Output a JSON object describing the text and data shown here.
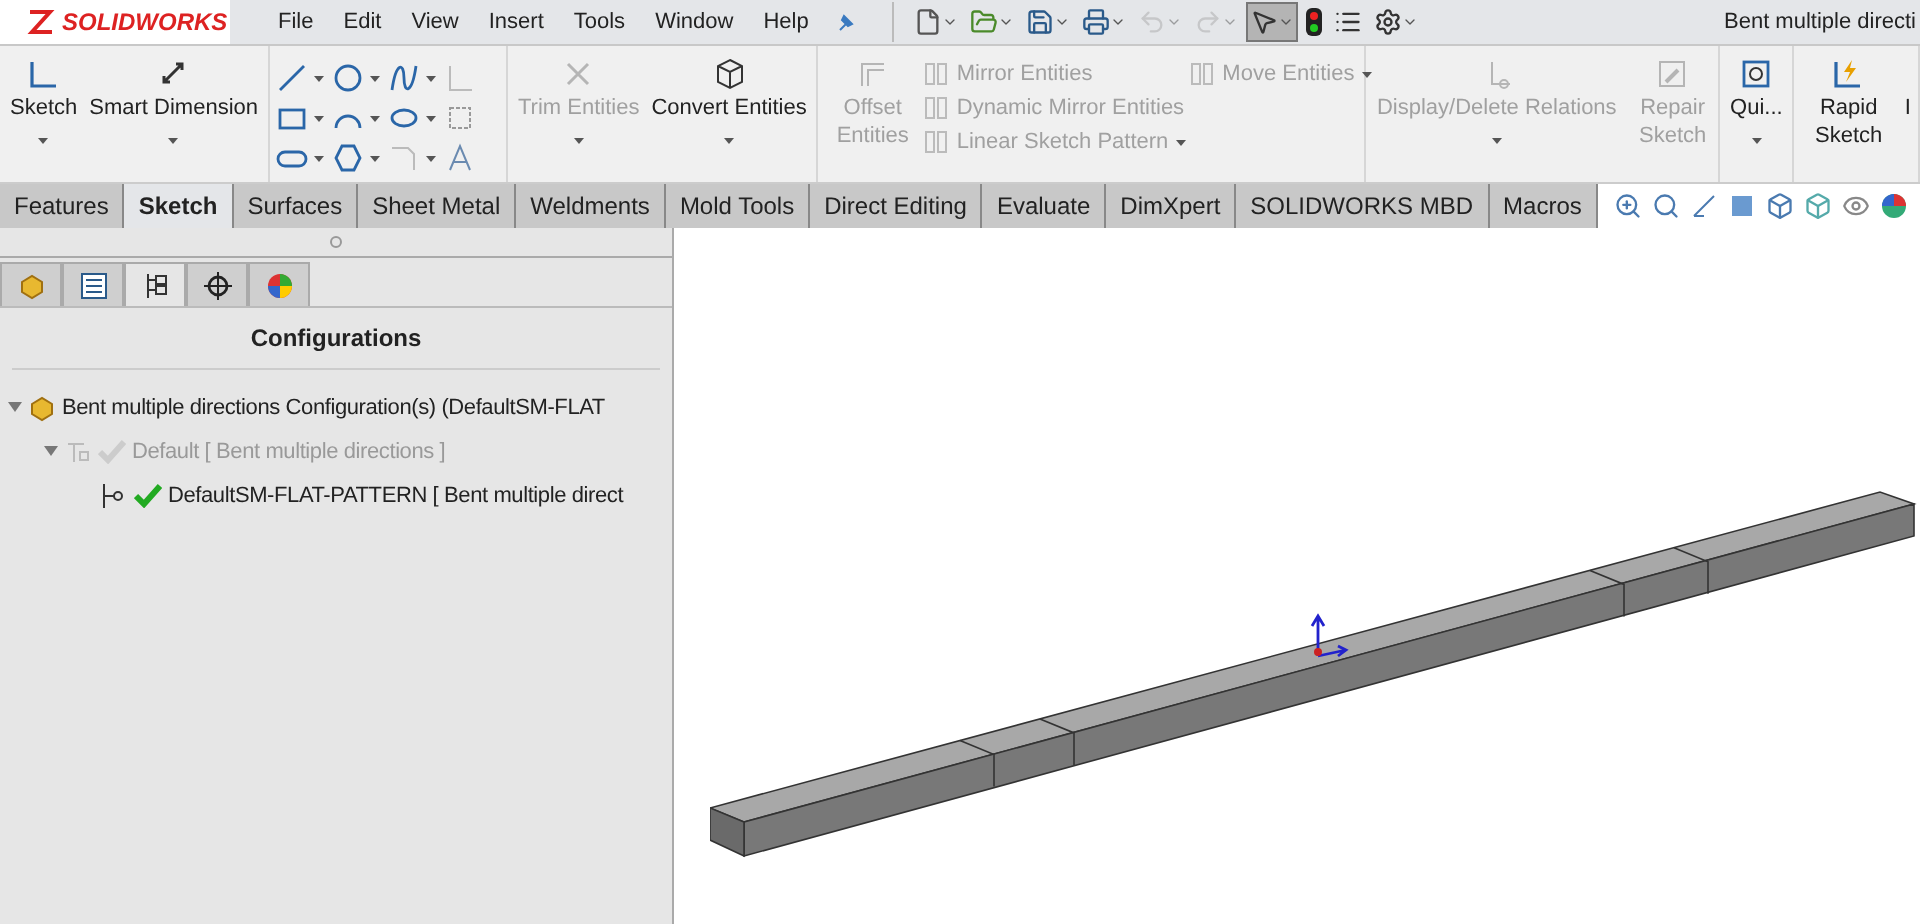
{
  "app": {
    "logo": "SOLIDWORKS",
    "menu": [
      "File",
      "Edit",
      "View",
      "Insert",
      "Tools",
      "Window",
      "Help"
    ],
    "title": "Bent multiple directi"
  },
  "quick_toolbar": [
    {
      "dropdown": true,
      "disabled": false,
      "selected": false
    },
    {
      "dropdown": true,
      "disabled": false,
      "selected": false
    },
    {
      "dropdown": true,
      "disabled": false,
      "selected": false
    },
    {
      "dropdown": true,
      "disabled": false,
      "selected": false
    },
    {
      "dropdown": true,
      "disabled": true,
      "selected": false
    },
    {
      "dropdown": true,
      "disabled": true,
      "selected": false
    },
    {
      "dropdown": true,
      "disabled": false,
      "selected": true
    },
    {
      "dropdown": false,
      "disabled": false,
      "selected": false
    },
    {
      "dropdown": false,
      "disabled": false,
      "selected": false
    },
    {
      "dropdown": true,
      "disabled": false,
      "selected": false
    }
  ],
  "ribbon": {
    "groups": [
      {
        "items": [
          {
            "kind": "large",
            "label": "Sketch",
            "disabled": false,
            "dropdown": true
          },
          {
            "kind": "large",
            "label": "Smart Dimension",
            "disabled": false,
            "dropdown": true
          }
        ]
      },
      {
        "items": [
          {
            "kind": "tools"
          }
        ]
      },
      {
        "items": [
          {
            "kind": "large",
            "label": "Trim Entities",
            "disabled": true,
            "dropdown": true
          },
          {
            "kind": "large",
            "label": "Convert Entities",
            "disabled": false,
            "dropdown": true
          }
        ]
      },
      {
        "items": [
          {
            "kind": "tall",
            "label": "Offset Entities",
            "disabled": true,
            "dropdown": false
          },
          {
            "kind": "stack",
            "items": [
              {
                "label": "Mirror Entities",
                "disabled": true,
                "dropdown": false
              },
              {
                "label": "Dynamic Mirror Entities",
                "disabled": true,
                "dropdown": false
              },
              {
                "label": "Linear Sketch Pattern",
                "disabled": true,
                "dropdown": true
              }
            ]
          },
          {
            "kind": "stack",
            "items": [
              {
                "label": "Move Entities",
                "disabled": true,
                "dropdown": true
              }
            ]
          }
        ]
      },
      {
        "items": [
          {
            "kind": "large",
            "label": "Display/Delete Relations",
            "disabled": true,
            "dropdown": true
          },
          {
            "kind": "tall",
            "label": "Repair Sketch",
            "disabled": true,
            "dropdown": false
          }
        ]
      },
      {
        "items": [
          {
            "kind": "large",
            "label": "Qui...",
            "disabled": false,
            "dropdown": true
          }
        ]
      },
      {
        "items": [
          {
            "kind": "tall",
            "label": "Rapid Sketch",
            "disabled": false,
            "dropdown": false
          },
          {
            "kind": "tall",
            "label": "I",
            "disabled": false,
            "dropdown": false
          }
        ]
      }
    ]
  },
  "tabs": [
    {
      "label": "Features",
      "selected": false
    },
    {
      "label": "Sketch",
      "selected": true
    },
    {
      "label": "Surfaces",
      "selected": false
    },
    {
      "label": "Sheet Metal",
      "selected": false
    },
    {
      "label": "Weldments",
      "selected": false
    },
    {
      "label": "Mold Tools",
      "selected": false
    },
    {
      "label": "Direct Editing",
      "selected": false
    },
    {
      "label": "Evaluate",
      "selected": false
    },
    {
      "label": "DimXpert",
      "selected": false
    },
    {
      "label": "SOLIDWORKS MBD",
      "selected": false
    },
    {
      "label": "Macros",
      "selected": false
    }
  ],
  "panel": {
    "tabs": [
      {
        "selected": false
      },
      {
        "selected": false
      },
      {
        "selected": true
      },
      {
        "selected": false
      },
      {
        "selected": false
      }
    ],
    "heading": "Configurations",
    "tree": [
      {
        "label": "Bent multiple directions Configuration(s)  (DefaultSM-FLAT",
        "checked": false,
        "disabled": false,
        "expanded": true,
        "children": [
          {
            "label": "Default [ Bent multiple directions ]",
            "checked": true,
            "disabled": true,
            "expanded": true,
            "children": [
              {
                "label": "DefaultSM-FLAT-PATTERN [ Bent multiple direct",
                "checked": true,
                "disabled": false
              }
            ]
          }
        ]
      }
    ]
  }
}
